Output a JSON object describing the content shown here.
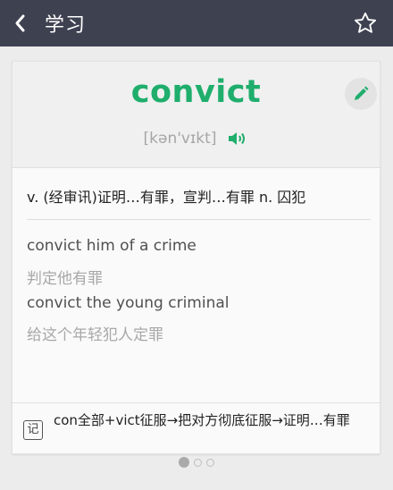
{
  "header": {
    "title": "学习",
    "back_icon": "chevron-left-icon",
    "favorite_icon": "star-outline-icon"
  },
  "card": {
    "word": "convict",
    "phonetic": "[kən'vɪkt]",
    "edit_icon": "pencil-icon",
    "speaker_icon": "speaker-icon",
    "accent_color": "#1fae6c",
    "definition": "v. (经审讯)证明…有罪，宣判…有罪  n. 囚犯",
    "examples": [
      {
        "en": "convict him of a crime",
        "zh": "判定他有罪"
      },
      {
        "en": "convict the young criminal",
        "zh": "给这个年轻犯人定罪"
      }
    ],
    "mnemonic_icon_label": "记",
    "mnemonic": "con全部+vict征服→把对方彻底征服→证明…有罪"
  },
  "pager": {
    "total": 3,
    "active": 1
  }
}
